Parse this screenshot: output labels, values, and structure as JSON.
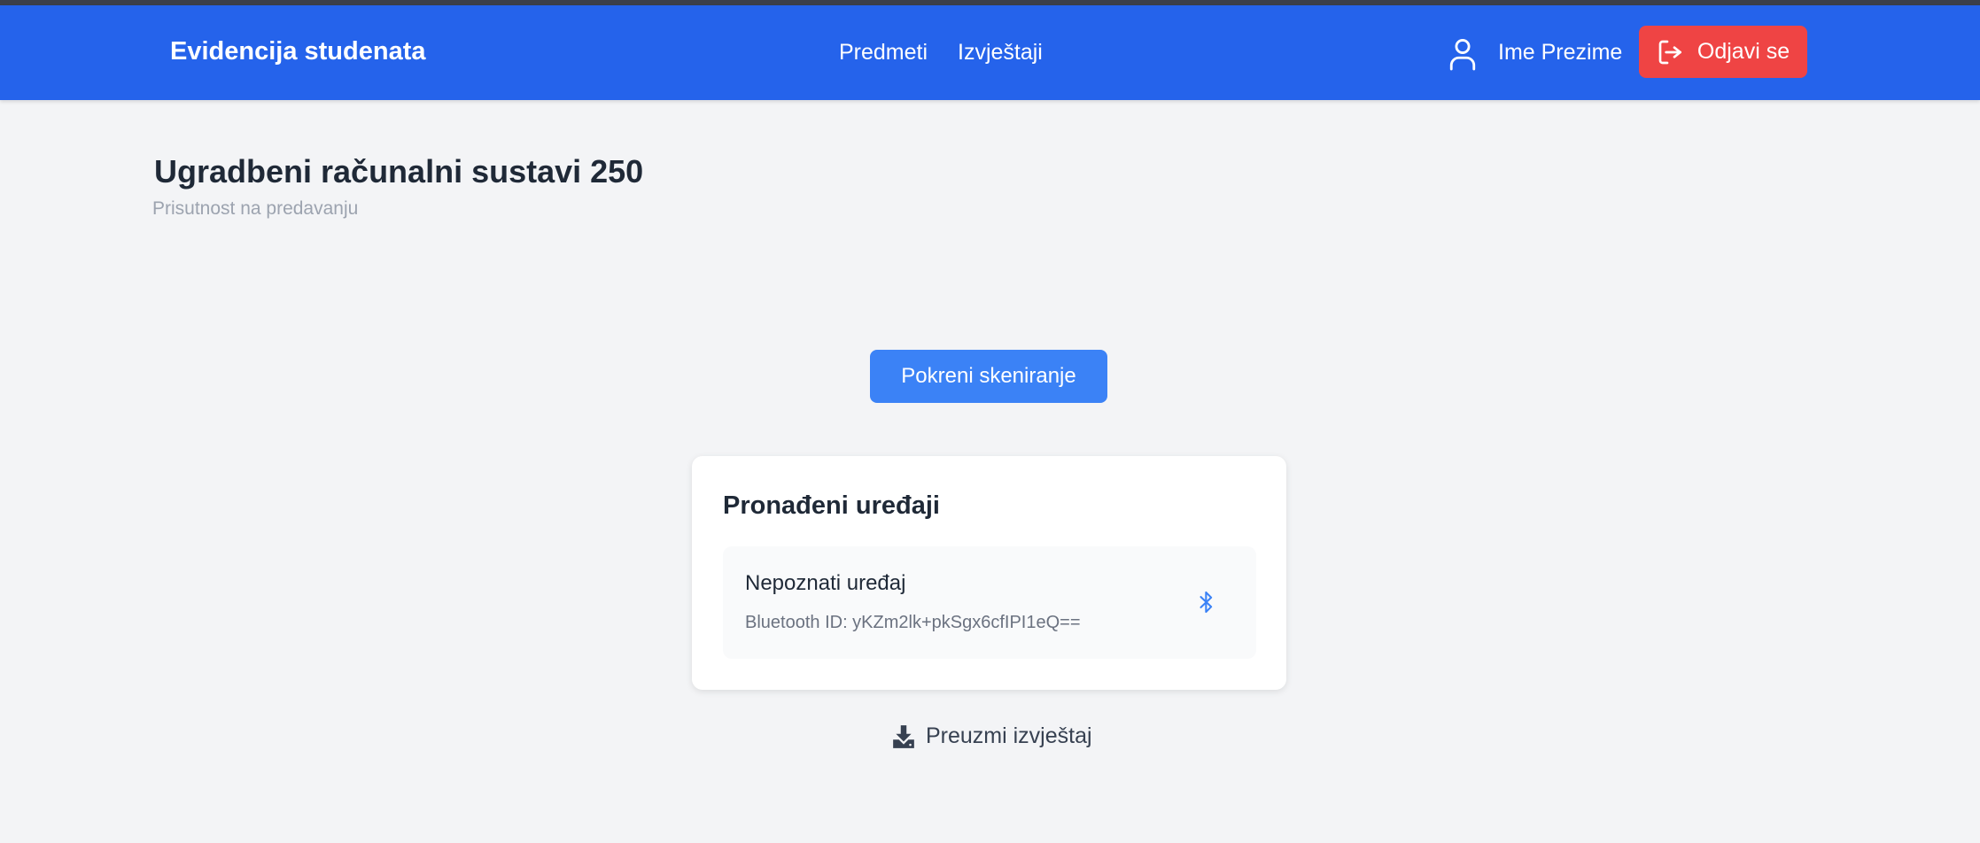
{
  "header": {
    "brand": "Evidencija studenata",
    "nav": [
      {
        "label": "Predmeti"
      },
      {
        "label": "Izvještaji"
      }
    ],
    "user": {
      "name": "Ime Prezime",
      "icon": "user-icon"
    },
    "logout": {
      "label": "Odjavi se",
      "icon": "logout-icon"
    }
  },
  "main": {
    "title": "Ugradbeni računalni sustavi 250",
    "subtitle": "Prisutnost na predavanju",
    "scan_button": "Pokreni skeniranje",
    "devices_card": {
      "title": "Pronađeni uređaji",
      "devices": [
        {
          "name": "Nepoznati uređaj",
          "bluetooth_id": "Bluetooth ID: yKZm2lk+pkSgx6cfIPI1eQ==",
          "icon": "bluetooth-icon"
        }
      ]
    },
    "download": {
      "label": "Preuzmi izvještaj",
      "icon": "download-icon"
    }
  },
  "colors": {
    "primary": "#2563eb",
    "button": "#3b82f6",
    "danger": "#ef4444",
    "background": "#f3f4f6"
  }
}
